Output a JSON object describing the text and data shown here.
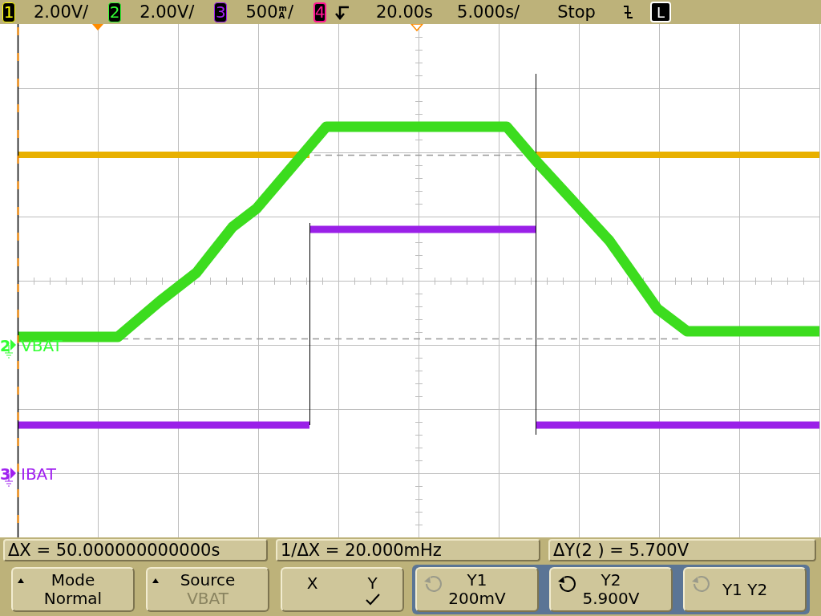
{
  "status_bar": {
    "channels": [
      {
        "number": "1",
        "scale": "2.00V/",
        "color": "#ffff00"
      },
      {
        "number": "2",
        "scale": "2.00V/",
        "color": "#33ff33"
      },
      {
        "number": "3",
        "scale": "500",
        "unit_prefix": "m",
        "unit": "A",
        "suffix": "/",
        "color": "#a020f0"
      },
      {
        "number": "4",
        "color": "#ff1493"
      }
    ],
    "trigger_delay": "20.00s",
    "timebase": "5.000s/",
    "run_state": "Stop",
    "mode": "L"
  },
  "traces": [
    {
      "number": "2",
      "label": "VBAT",
      "color": "#33ff33"
    },
    {
      "number": "3",
      "label": "IBAT",
      "color": "#a020f0"
    }
  ],
  "measurements": [
    "ΔX = 50.000000000000s",
    "1/ΔX = 20.000mHz",
    "ΔY(2 ) = 5.700V"
  ],
  "softkeys": [
    {
      "kind": "menu",
      "label": "Mode",
      "value": "Normal",
      "greyed": false
    },
    {
      "kind": "menu",
      "label": "Source",
      "value": "VBAT",
      "greyed": true
    },
    {
      "kind": "toggle",
      "options": [
        {
          "label": "X",
          "selected": false
        },
        {
          "label": "Y",
          "selected": true
        }
      ]
    },
    {
      "kind": "knob",
      "label": "Y1",
      "value": "200mV",
      "active": false
    },
    {
      "kind": "knob",
      "label": "Y2",
      "value": "5.900V",
      "active": true
    },
    {
      "kind": "knob",
      "label": "Y1 Y2",
      "active": false
    }
  ]
}
